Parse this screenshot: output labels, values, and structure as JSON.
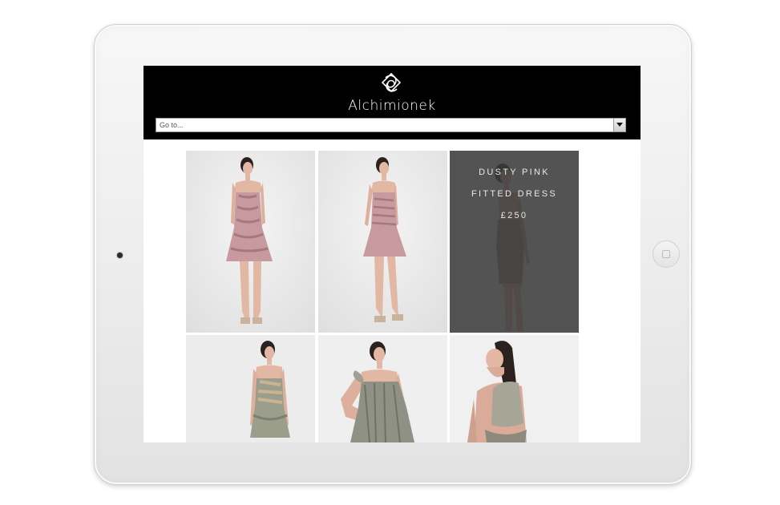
{
  "site": {
    "brand": "Alchimionek"
  },
  "nav": {
    "goto_placeholder": "Go to..."
  },
  "products": [
    {
      "name": "product-1",
      "dress_color": "#c79aa0"
    },
    {
      "name": "product-2",
      "dress_color": "#c79aa0"
    },
    {
      "name": "product-3",
      "dress_color": "#9a7f80",
      "overlay": {
        "line1": "DUSTY PINK",
        "line2": "FITTED DRESS",
        "price": "£250"
      }
    },
    {
      "name": "product-4",
      "dress_color": "#9c9e8c"
    },
    {
      "name": "product-5",
      "dress_color": "#8f9184"
    },
    {
      "name": "product-6",
      "dress_color": "#a7a596"
    }
  ],
  "colors": {
    "header_bg": "#000000",
    "overlay_bg": "#3a3a3a",
    "device_body": "#eeeeee"
  }
}
